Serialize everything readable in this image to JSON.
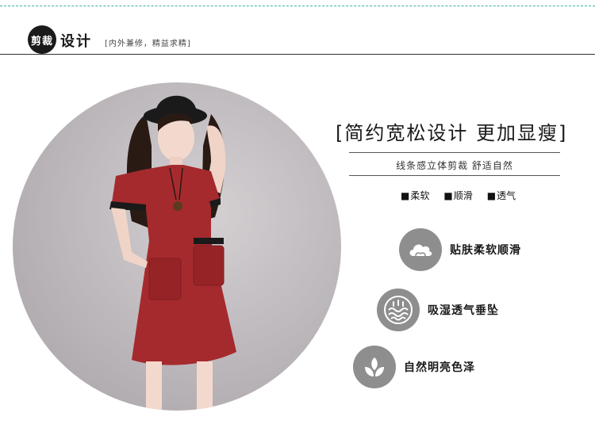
{
  "header": {
    "badge": "剪裁",
    "title": "设计",
    "subtitle": "[内外兼修，精益求精]"
  },
  "detail": {
    "headline": "[简约宽松设计 更加显瘦]",
    "subline": "线条感立体剪裁 舒适自然",
    "tags": [
      "柔软",
      "顺滑",
      "透气"
    ]
  },
  "features": [
    {
      "icon": "cloud-icon",
      "label": "贴肤柔软顺滑"
    },
    {
      "icon": "moisture-wave-icon",
      "label": "吸湿透气垂坠"
    },
    {
      "icon": "leaf-sprout-icon",
      "label": "自然明亮色泽"
    }
  ],
  "colors": {
    "accent_teal": "#39b3a8",
    "dress_red": "#a52a2d",
    "icon_grey": "#8e8e8e"
  }
}
